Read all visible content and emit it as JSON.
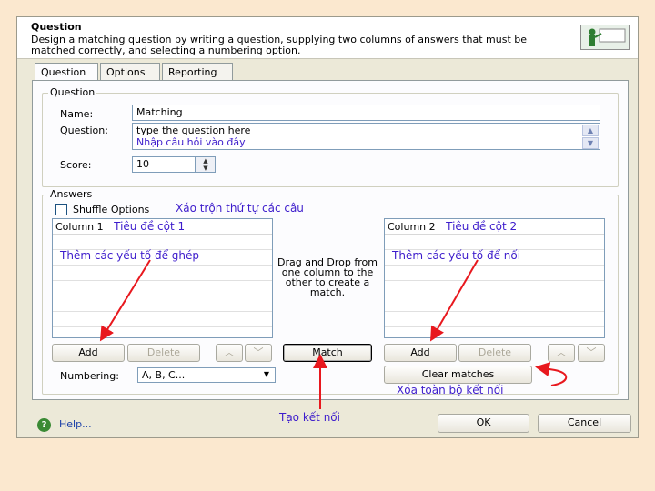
{
  "header": {
    "title": "Question",
    "description": "Design a matching question by writing a question, supplying two columns of answers that must be matched correctly, and selecting a numbering option."
  },
  "tabs": [
    "Question",
    "Options",
    "Reporting"
  ],
  "question_group": {
    "legend": "Question",
    "name_label": "Name:",
    "name_value": "Matching",
    "question_label": "Question:",
    "question_text": "type the question here",
    "question_note": "Nhập câu hỏi vào đây",
    "score_label": "Score:",
    "score_value": "10"
  },
  "answers_group": {
    "legend": "Answers",
    "shuffle_label": "Shuffle Options",
    "shuffle_checked": false,
    "shuffle_note": "Xáo trộn thứ tự các câu",
    "column1_header": "Column 1",
    "column1_note": "Tiêu đề cột 1",
    "column1_item_note": "Thêm các yếu tố để ghép",
    "column2_header": "Column 2",
    "column2_note": "Tiêu đề cột 2",
    "column2_item_note": "Thêm các yếu tố để nối",
    "drag_hint": "Drag and Drop from one column to the other to create a match.",
    "add_label": "Add",
    "delete_label": "Delete",
    "match_label": "Match",
    "clear_label": "Clear matches",
    "clear_note": "Xóa toàn bộ kết nối",
    "numbering_label": "Numbering:",
    "numbering_value": "A, B, C..."
  },
  "footer": {
    "help_label": "Help...",
    "match_note": "Tạo kết nối",
    "ok_label": "OK",
    "cancel_label": "Cancel"
  },
  "colors": {
    "annotation_text": "#3d1ccc",
    "arrow": "#e8181e"
  }
}
